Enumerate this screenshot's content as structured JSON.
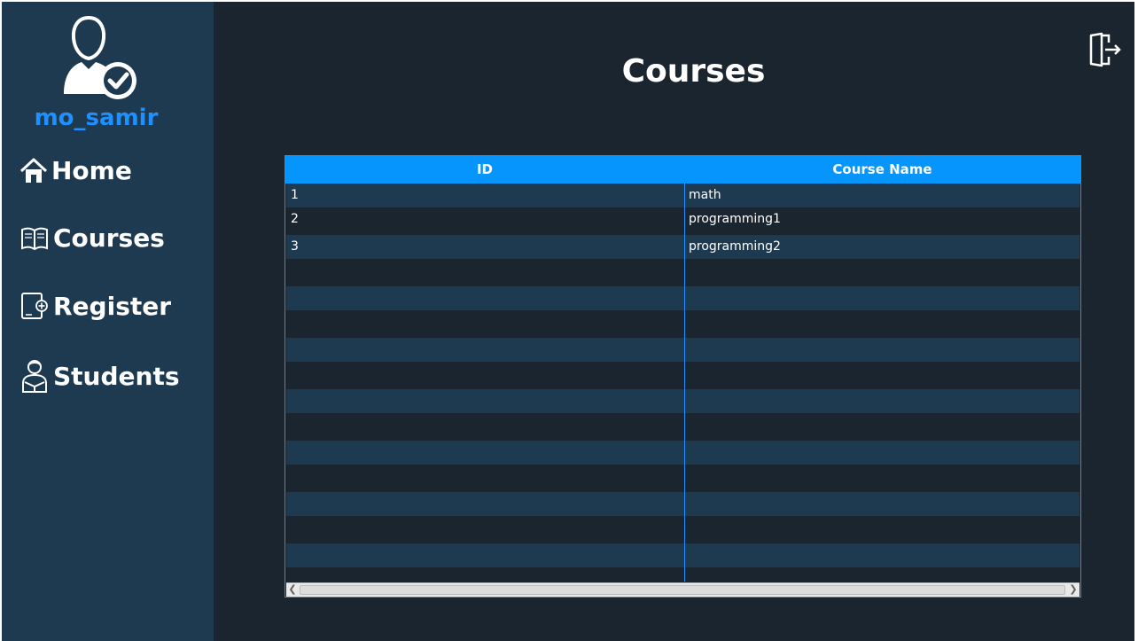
{
  "sidebar": {
    "username": "mo_samir",
    "avatar_icon": "user-check-icon",
    "items": [
      {
        "label": "Home",
        "icon": "home-icon"
      },
      {
        "label": "Courses",
        "icon": "book-icon"
      },
      {
        "label": "Register",
        "icon": "register-icon"
      },
      {
        "label": "Students",
        "icon": "student-icon"
      }
    ]
  },
  "main": {
    "title": "Courses",
    "logout_icon": "logout-icon"
  },
  "table": {
    "columns": [
      "ID",
      "Course Name"
    ],
    "rows": [
      [
        "1",
        "math"
      ],
      [
        "2",
        "programming1"
      ],
      [
        "3",
        "programming2"
      ],
      [
        "",
        ""
      ],
      [
        "",
        ""
      ],
      [
        "",
        ""
      ],
      [
        "",
        ""
      ],
      [
        "",
        ""
      ],
      [
        "",
        ""
      ],
      [
        "",
        ""
      ],
      [
        "",
        ""
      ],
      [
        "",
        ""
      ],
      [
        "",
        ""
      ],
      [
        "",
        ""
      ],
      [
        "",
        ""
      ],
      [
        "",
        ""
      ]
    ]
  },
  "colors": {
    "sidebar_bg": "#1e3a51",
    "main_bg": "#1a2530",
    "accent": "#0595fc",
    "username": "#1e90ff"
  }
}
